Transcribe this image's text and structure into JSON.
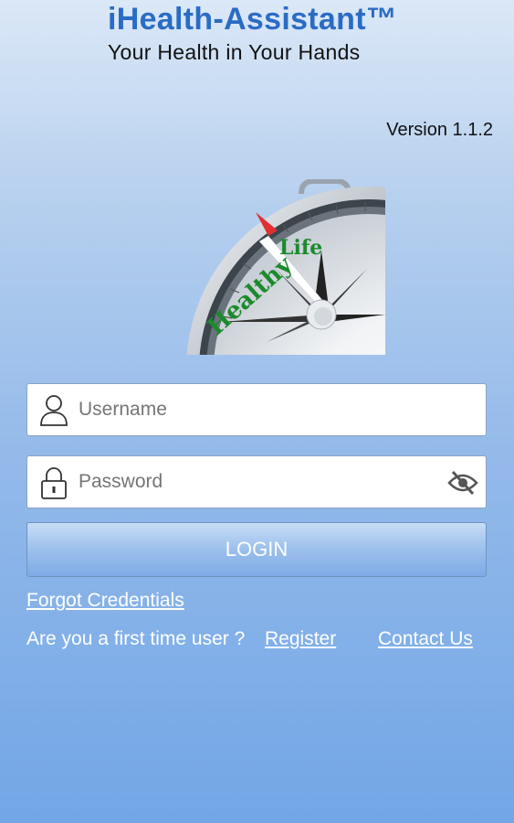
{
  "app": {
    "title": "iHealth-Assistant™",
    "tagline": "Your Health in Your Hands",
    "version": "Version 1.1.2"
  },
  "logo": {
    "compass_text": "Healthy Life"
  },
  "form": {
    "username_placeholder": "Username",
    "password_placeholder": "Password",
    "login_label": "LOGIN"
  },
  "links": {
    "forgot": "Forgot Credentials",
    "first_time": "Are you a first time user ?",
    "register": "Register",
    "contact": "Contact Us"
  },
  "icons": {
    "user": "user-icon",
    "lock": "lock-icon",
    "eye": "eye-off-icon"
  },
  "colors": {
    "brand": "#2a6cc4",
    "compass_text": "#1c8a2c",
    "needle": "#e03030"
  }
}
